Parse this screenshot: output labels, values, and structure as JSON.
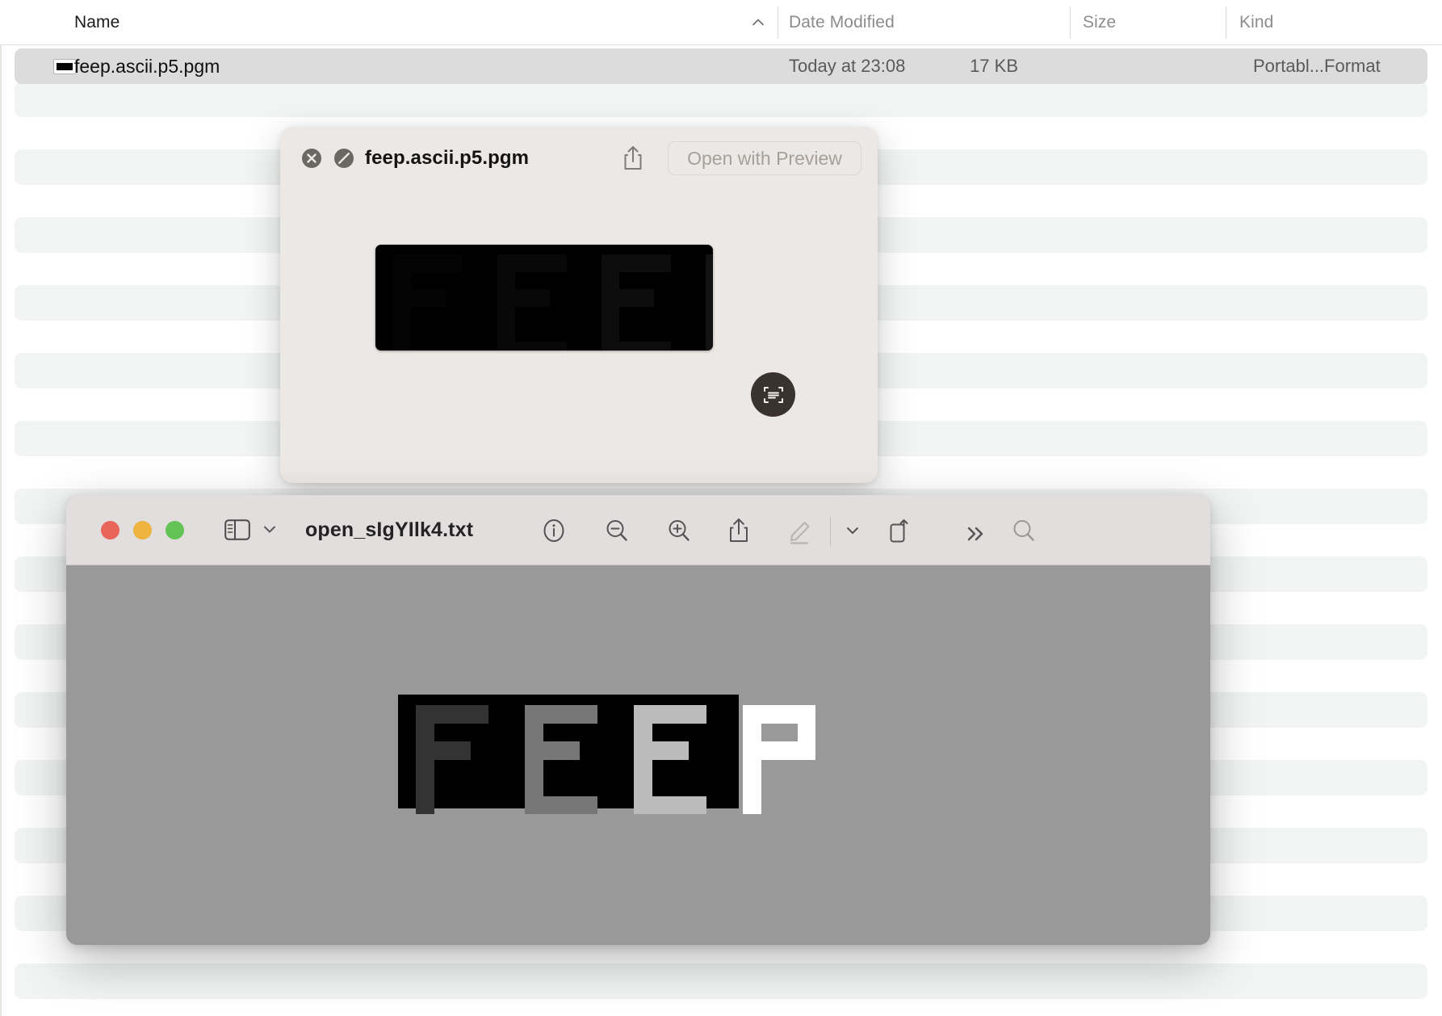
{
  "finder": {
    "columns": [
      {
        "key": "name",
        "label": "Name"
      },
      {
        "key": "date",
        "label": "Date Modified"
      },
      {
        "key": "size",
        "label": "Size"
      },
      {
        "key": "kind",
        "label": "Kind"
      }
    ],
    "sort_indicator": "chevron-up",
    "rows": [
      {
        "name": "feep.ascii.p5.pgm",
        "date": "Today at 23:08",
        "size": "17 KB",
        "kind": "Portabl...Format",
        "selected": true
      }
    ],
    "stripe_count": 22
  },
  "quicklook": {
    "title": "feep.ascii.p5.pgm",
    "close_label": "Close",
    "noentry_label": "No Entry",
    "share_label": "Share",
    "open_with_label": "Open with Preview",
    "live_text_label": "Live Text",
    "preview_alt": "FEEP grayscale bitmap"
  },
  "preview": {
    "title": "open_sIgYIlk4.txt",
    "traffic_lights": [
      {
        "name": "close",
        "color": "#e8655a"
      },
      {
        "name": "minimize",
        "color": "#eeb33d"
      },
      {
        "name": "zoom",
        "color": "#63c354"
      }
    ],
    "sidebar_label": "Sidebar",
    "sidebar_menu_label": "Sidebar Options",
    "tools": [
      {
        "name": "info",
        "label": "Info"
      },
      {
        "name": "zoom-out",
        "label": "Zoom Out"
      },
      {
        "name": "zoom-in",
        "label": "Zoom In"
      },
      {
        "name": "share",
        "label": "Share"
      },
      {
        "name": "markup",
        "label": "Markup",
        "disabled": true
      },
      {
        "name": "chevron-down",
        "label": "More Options"
      },
      {
        "name": "rotate",
        "label": "Rotate"
      },
      {
        "name": "more",
        "label": "More Toolbar Items"
      },
      {
        "name": "search",
        "label": "Search"
      }
    ],
    "canvas_background": "#999999"
  },
  "artwork": {
    "name": "FEEP",
    "description": "4-letter grayscale PGM test image, letters increasing in brightness",
    "background": "#000000",
    "letters": [
      {
        "glyph": "F",
        "gray": 51,
        "hex": "#333333"
      },
      {
        "glyph": "E",
        "gray": 119,
        "hex": "#777777"
      },
      {
        "glyph": "E",
        "gray": 187,
        "hex": "#bbbbbb"
      },
      {
        "glyph": "P",
        "gray": 255,
        "hex": "#ffffff"
      }
    ],
    "grid": {
      "cols": 24,
      "rows": 7
    },
    "pixels": {
      "F": [
        [
          0,
          0
        ],
        [
          1,
          0
        ],
        [
          2,
          0
        ],
        [
          3,
          0
        ],
        [
          0,
          1
        ],
        [
          0,
          2
        ],
        [
          1,
          2
        ],
        [
          2,
          2
        ],
        [
          0,
          3
        ],
        [
          0,
          4
        ],
        [
          0,
          5
        ]
      ],
      "E": [
        [
          0,
          0
        ],
        [
          1,
          0
        ],
        [
          2,
          0
        ],
        [
          3,
          0
        ],
        [
          0,
          1
        ],
        [
          0,
          2
        ],
        [
          1,
          2
        ],
        [
          2,
          2
        ],
        [
          0,
          3
        ],
        [
          0,
          4
        ],
        [
          0,
          5
        ],
        [
          1,
          5
        ],
        [
          2,
          5
        ],
        [
          3,
          5
        ]
      ],
      "P": [
        [
          0,
          0
        ],
        [
          1,
          0
        ],
        [
          2,
          0
        ],
        [
          3,
          0
        ],
        [
          0,
          1
        ],
        [
          3,
          1
        ],
        [
          0,
          2
        ],
        [
          1,
          2
        ],
        [
          2,
          2
        ],
        [
          3,
          2
        ],
        [
          0,
          3
        ],
        [
          0,
          4
        ],
        [
          0,
          5
        ]
      ]
    }
  }
}
